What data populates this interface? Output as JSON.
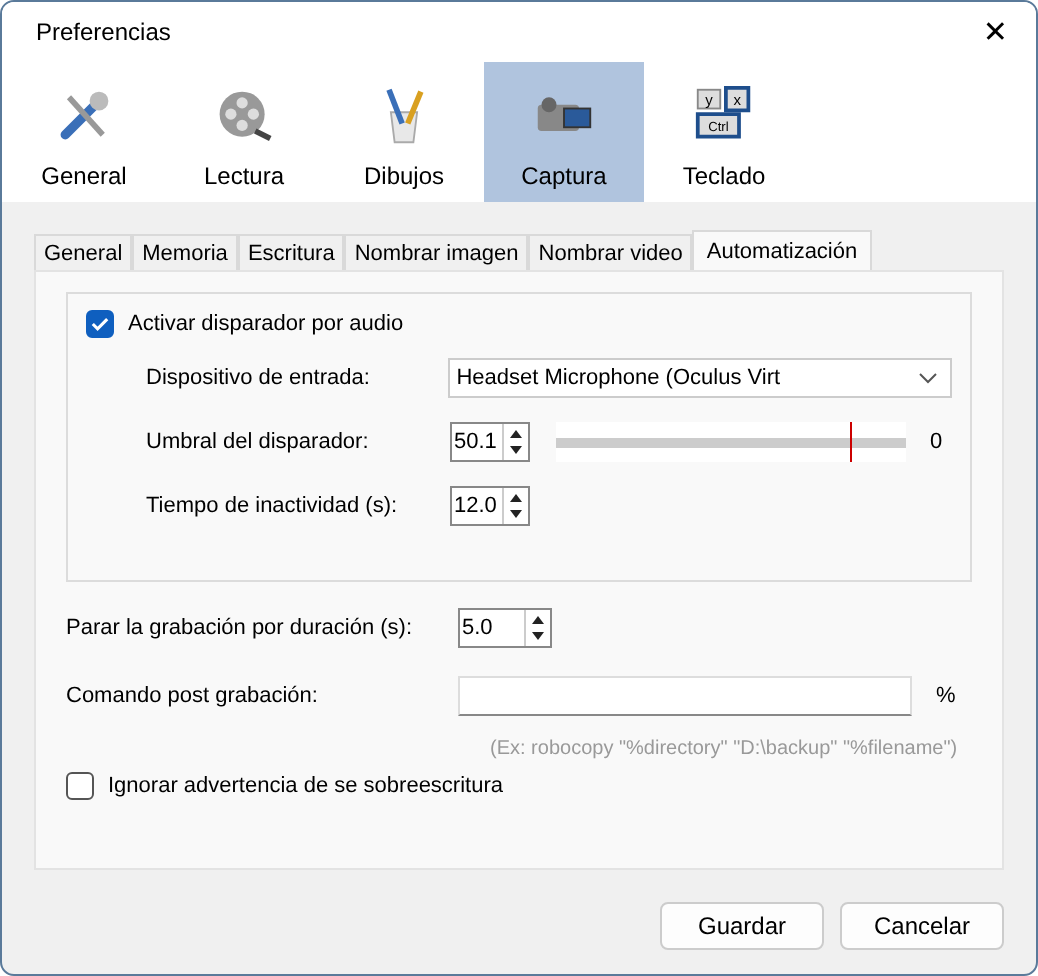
{
  "window": {
    "title": "Preferencias",
    "close": "✕"
  },
  "categories": [
    {
      "label": "General",
      "kind": "tools",
      "selected": false
    },
    {
      "label": "Lectura",
      "kind": "reel",
      "selected": false
    },
    {
      "label": "Dibujos",
      "kind": "brushes",
      "selected": false
    },
    {
      "label": "Captura",
      "kind": "camera",
      "selected": true
    },
    {
      "label": "Teclado",
      "kind": "keys",
      "selected": false,
      "keys": [
        "y",
        "x",
        "Ctrl"
      ]
    }
  ],
  "tabs": [
    {
      "label": "General",
      "selected": false
    },
    {
      "label": "Memoria",
      "selected": false
    },
    {
      "label": "Escritura",
      "selected": false
    },
    {
      "label": "Nombrar imagen",
      "selected": false
    },
    {
      "label": "Nombrar video",
      "selected": false
    },
    {
      "label": "Automatización",
      "selected": true
    }
  ],
  "audio_trigger": {
    "label": "Activar disparador por audio",
    "checked": true,
    "device": {
      "label": "Dispositivo de entrada:",
      "value": "Headset Microphone (Oculus Virt"
    },
    "threshold": {
      "label": "Umbral del disparador:",
      "value": "50.1",
      "level": 0.84,
      "reading": "0"
    },
    "idle": {
      "label": "Tiempo de inactividad (s):",
      "value": "12.0"
    }
  },
  "stop_duration": {
    "label": "Parar la grabación por duración (s):",
    "value": "5.0"
  },
  "post_command": {
    "label": "Comando post grabación:",
    "suffix": "%",
    "hint": "(Ex: robocopy \"%directory\" \"D:\\backup\" \"%filename\")"
  },
  "ignore_overwrite": {
    "label": "Ignorar advertencia de se sobreescritura",
    "checked": false
  },
  "buttons": [
    "Guardar",
    "Cancelar"
  ]
}
